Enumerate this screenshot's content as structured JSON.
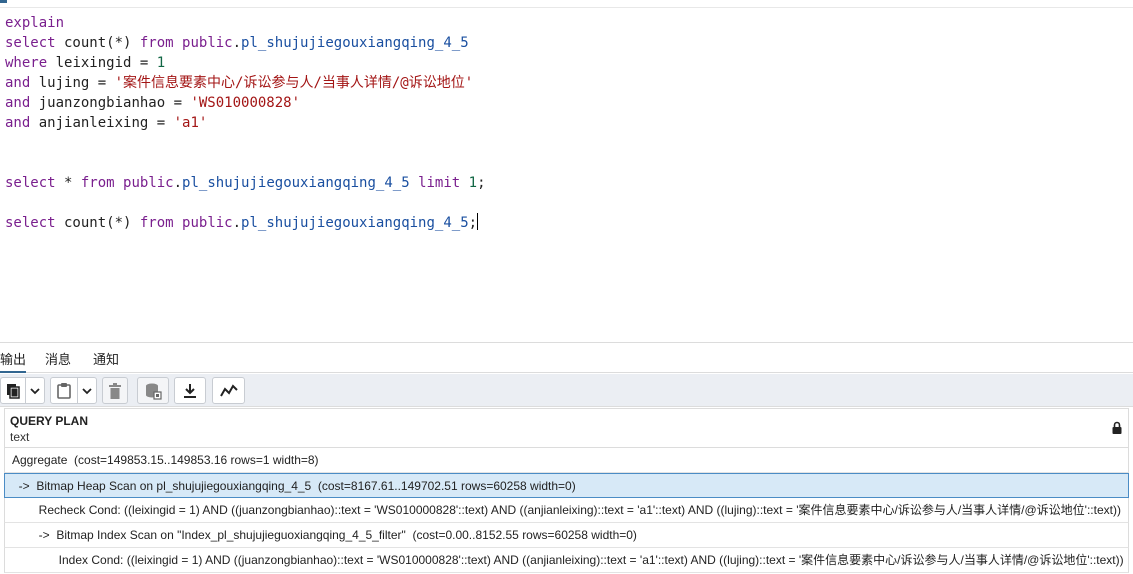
{
  "editor": {
    "lines": [
      [
        {
          "t": "explain",
          "c": "kw"
        }
      ],
      [
        {
          "t": "select",
          "c": "kw"
        },
        {
          "t": " count",
          "c": "fn"
        },
        {
          "t": "(*) ",
          "c": "fn"
        },
        {
          "t": "from",
          "c": "kw"
        },
        {
          "t": " ",
          "c": "fn"
        },
        {
          "t": "public",
          "c": "kw"
        },
        {
          "t": ".",
          "c": "fn"
        },
        {
          "t": "pl_shujujiegouxiangqing_4_5",
          "c": "ident"
        }
      ],
      [
        {
          "t": "where",
          "c": "kw"
        },
        {
          "t": " leixingid = ",
          "c": "fn"
        },
        {
          "t": "1",
          "c": "num"
        }
      ],
      [
        {
          "t": "and",
          "c": "kw"
        },
        {
          "t": " lujing = ",
          "c": "fn"
        },
        {
          "t": "'案件信息要素中心/诉讼参与人/当事人详情/@诉讼地位'",
          "c": "str"
        }
      ],
      [
        {
          "t": "and",
          "c": "kw"
        },
        {
          "t": " juanzongbianhao = ",
          "c": "fn"
        },
        {
          "t": "'WS010000828'",
          "c": "str"
        }
      ],
      [
        {
          "t": "and",
          "c": "kw"
        },
        {
          "t": " anjianleixing = ",
          "c": "fn"
        },
        {
          "t": "'a1'",
          "c": "str"
        }
      ],
      [],
      [],
      [
        {
          "t": "select",
          "c": "kw"
        },
        {
          "t": " * ",
          "c": "fn"
        },
        {
          "t": "from",
          "c": "kw"
        },
        {
          "t": " ",
          "c": "fn"
        },
        {
          "t": "public",
          "c": "kw"
        },
        {
          "t": ".",
          "c": "fn"
        },
        {
          "t": "pl_shujujiegouxiangqing_4_5",
          "c": "ident"
        },
        {
          "t": " ",
          "c": "fn"
        },
        {
          "t": "limit",
          "c": "kw"
        },
        {
          "t": " ",
          "c": "fn"
        },
        {
          "t": "1",
          "c": "num"
        },
        {
          "t": ";",
          "c": "fn"
        }
      ],
      [],
      [
        {
          "t": "select",
          "c": "kw"
        },
        {
          "t": " count",
          "c": "fn"
        },
        {
          "t": "(*) ",
          "c": "fn"
        },
        {
          "t": "from",
          "c": "kw"
        },
        {
          "t": " ",
          "c": "fn"
        },
        {
          "t": "public",
          "c": "kw"
        },
        {
          "t": ".",
          "c": "fn"
        },
        {
          "t": "pl_shujujiegouxiangqing_4_5",
          "c": "ident"
        },
        {
          "t": ";",
          "c": "fn"
        }
      ]
    ]
  },
  "tabs": [
    {
      "label": "输出",
      "active": true
    },
    {
      "label": "消息",
      "active": false
    },
    {
      "label": "通知",
      "active": false
    }
  ],
  "toolbar": {
    "buttons": [
      "copy-icon",
      "chevron-down-icon",
      "paste-icon",
      "chevron-down-icon",
      "delete-icon",
      "save-data-icon",
      "download-icon",
      "graph-icon"
    ]
  },
  "grid": {
    "column_name": "QUERY PLAN",
    "column_type": "text",
    "rows": [
      "Aggregate  (cost=149853.15..149853.16 rows=1 width=8)",
      "  ->  Bitmap Heap Scan on pl_shujujiegouxiangqing_4_5  (cost=8167.61..149702.51 rows=60258 width=0)",
      "        Recheck Cond: ((leixingid = 1) AND ((juanzongbianhao)::text = 'WS010000828'::text) AND ((anjianleixing)::text = 'a1'::text) AND ((lujing)::text = '案件信息要素中心/诉讼参与人/当事人详情/@诉讼地位'::text))",
      "        ->  Bitmap Index Scan on \"Index_pl_shujujieguoxiangqing_4_5_filter\"  (cost=0.00..8152.55 rows=60258 width=0)",
      "              Index Cond: ((leixingid = 1) AND ((juanzongbianhao)::text = 'WS010000828'::text) AND ((anjianleixing)::text = 'a1'::text) AND ((lujing)::text = '案件信息要素中心/诉讼参与人/当事人详情/@诉讼地位'::text))"
    ],
    "selected_row": 1
  }
}
